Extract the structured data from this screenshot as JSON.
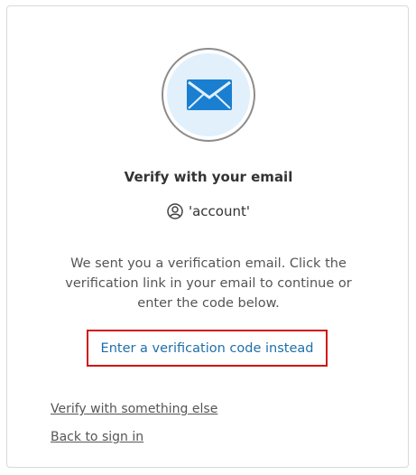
{
  "header": {
    "title": "Verify with your email",
    "account_label": "'account'"
  },
  "body": {
    "message": "We sent you a verification email. Click the verification link in your email to continue or enter the code below."
  },
  "actions": {
    "code_link_label": "Enter a verification code instead",
    "verify_else_label": "Verify with something else",
    "back_to_sign_in_label": "Back to sign in"
  },
  "icons": {
    "top": "envelope-icon",
    "account": "user-circle-icon"
  },
  "colors": {
    "link": "#1f6fa8",
    "highlight_border": "#d11414",
    "envelope": "#1a7fd1",
    "envelope_bg": "#e1f0fb"
  }
}
